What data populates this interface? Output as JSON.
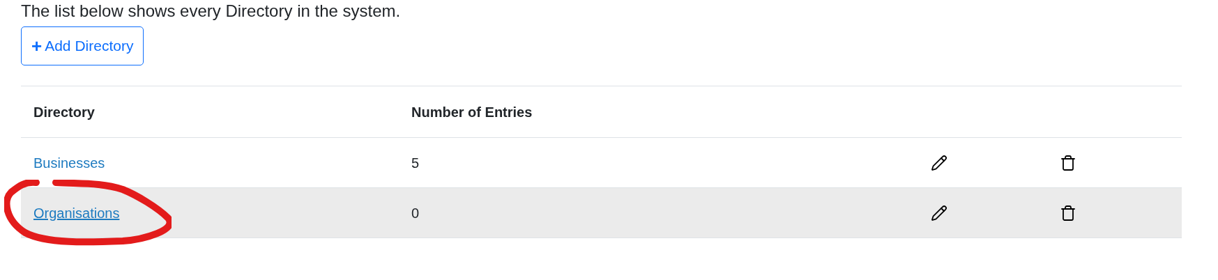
{
  "intro": "The list below shows every Directory in the system.",
  "add_button": {
    "icon": "+",
    "label": "Add Directory"
  },
  "table": {
    "columns": [
      "Directory",
      "Number of Entries"
    ],
    "rows": [
      {
        "name": "Businesses",
        "entries": "5",
        "hovered": false
      },
      {
        "name": "Organisations",
        "entries": "0",
        "hovered": true,
        "circled": true
      }
    ]
  },
  "annotation": {
    "kind": "circle",
    "color": "#e31b1b"
  }
}
